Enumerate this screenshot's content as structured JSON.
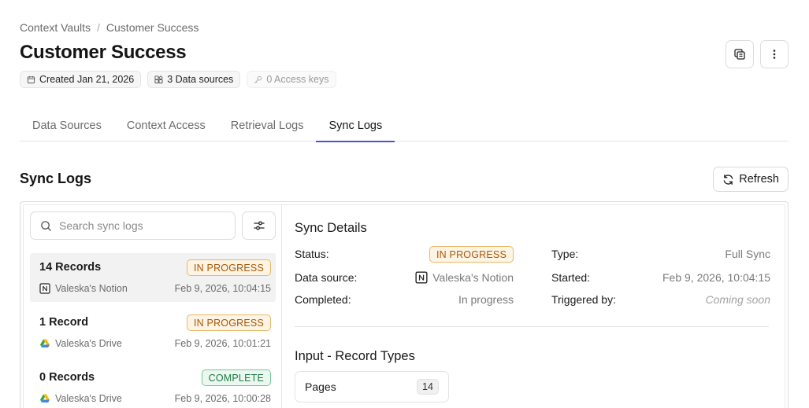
{
  "breadcrumb": {
    "root": "Context Vaults",
    "separator": "/",
    "current": "Customer Success"
  },
  "page_title": "Customer Success",
  "meta": {
    "created": "Created Jan 21, 2026",
    "data_sources": "3 Data sources",
    "access_keys": "0 Access keys"
  },
  "tabs": [
    {
      "label": "Data Sources",
      "active": false
    },
    {
      "label": "Context Access",
      "active": false
    },
    {
      "label": "Retrieval Logs",
      "active": false
    },
    {
      "label": "Sync Logs",
      "active": true
    }
  ],
  "section": {
    "title": "Sync Logs",
    "refresh_label": "Refresh"
  },
  "search": {
    "placeholder": "Search sync logs"
  },
  "logs": [
    {
      "title": "14 Records",
      "status": "IN PROGRESS",
      "source_icon": "notion-icon",
      "source": "Valeska's Notion",
      "time": "Feb 9, 2026, 10:04:15",
      "selected": true
    },
    {
      "title": "1 Record",
      "status": "IN PROGRESS",
      "source_icon": "google-drive-icon",
      "source": "Valeska's Drive",
      "time": "Feb 9, 2026, 10:01:21",
      "selected": false
    },
    {
      "title": "0 Records",
      "status": "COMPLETE",
      "source_icon": "google-drive-icon",
      "source": "Valeska's Drive",
      "time": "Feb 9, 2026, 10:00:28",
      "selected": false
    }
  ],
  "details": {
    "title": "Sync Details",
    "status_label": "Status:",
    "status_value": "IN PROGRESS",
    "type_label": "Type:",
    "type_value": "Full Sync",
    "source_label": "Data source:",
    "source_value": "Valeska's Notion",
    "started_label": "Started:",
    "started_value": "Feb 9, 2026, 10:04:15",
    "completed_label": "Completed:",
    "completed_value": "In progress",
    "triggered_label": "Triggered by:",
    "triggered_value": "Coming soon"
  },
  "input": {
    "title": "Input - Record Types",
    "record_types": [
      {
        "label": "Pages",
        "count": "14"
      }
    ]
  },
  "colors": {
    "accent": "#4b4ee0",
    "in_progress_text": "#a9570a",
    "in_progress_bg": "#fdf4e3",
    "complete_text": "#1e7a45",
    "complete_bg": "#ebf8ef"
  }
}
